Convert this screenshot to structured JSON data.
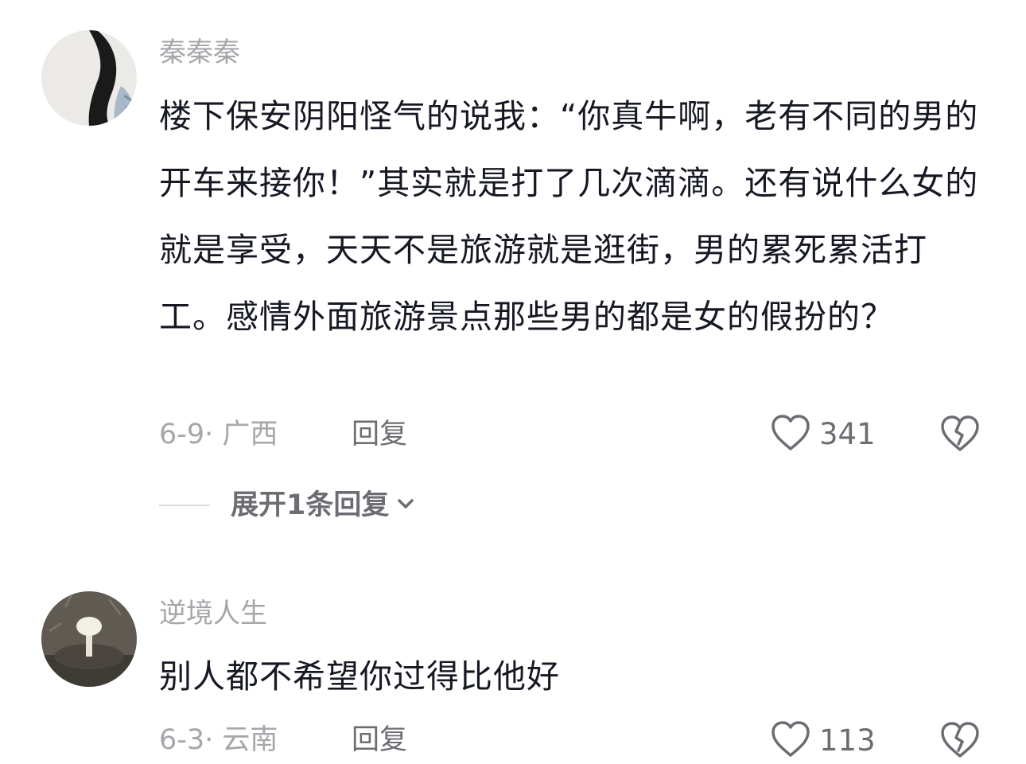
{
  "comments": [
    {
      "username": "秦秦秦",
      "avatar_icon": "avatar-photo-girl",
      "content": "楼下保安阴阳怪气的说我：“你真牛啊，老有不同的男的开车来接你！”其实就是打了几次滴滴。还有说什么女的就是享受，天天不是旅游就是逛街，男的累死累活打工。感情外面旅游景点那些男的都是女的假扮的？",
      "date_region": "6-9· 广西",
      "reply_label": "回复",
      "like_count": "341",
      "expand_label": "展开1条回复"
    },
    {
      "username": "逆境人生",
      "avatar_icon": "avatar-photo-mushroom",
      "content": "别人都不希望你过得比他好",
      "date_region": "6-3· 云南",
      "reply_label": "回复",
      "like_count": "113"
    }
  ],
  "icons": {
    "like": "heart-outline-icon",
    "dislike": "broken-heart-icon",
    "expand": "chevron-down-icon"
  },
  "colors": {
    "text_primary": "#161823",
    "text_secondary": "#a6a6ab",
    "text_action": "#6c6d72"
  }
}
